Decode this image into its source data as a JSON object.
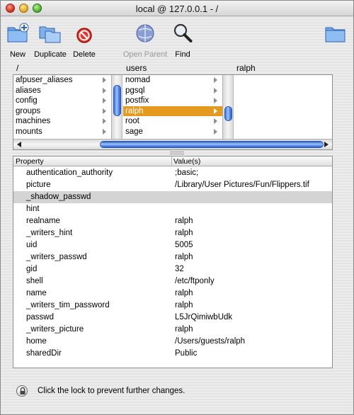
{
  "window": {
    "title": "local @ 127.0.0.1 - /"
  },
  "toolbar": {
    "new_label": "New",
    "duplicate_label": "Duplicate",
    "delete_label": "Delete",
    "open_parent_label": "Open Parent",
    "find_label": "Find"
  },
  "browser": {
    "column_headers": [
      "/",
      "users",
      "ralph"
    ],
    "column1_items": [
      "afpuser_aliases",
      "aliases",
      "config",
      "groups",
      "machines",
      "mounts"
    ],
    "column2_items": [
      "nomad",
      "pgsql",
      "postfix",
      "ralph",
      "root",
      "sage"
    ],
    "column2_selected": "ralph"
  },
  "properties": {
    "header_property": "Property",
    "header_value": "Value(s)",
    "rows": [
      {
        "name": "authentication_authority",
        "value": ";basic;"
      },
      {
        "name": "picture",
        "value": "/Library/User Pictures/Fun/Flippers.tif"
      },
      {
        "name": "_shadow_passwd",
        "value": ""
      },
      {
        "name": "hint",
        "value": ""
      },
      {
        "name": "realname",
        "value": "ralph"
      },
      {
        "name": "_writers_hint",
        "value": "ralph"
      },
      {
        "name": "uid",
        "value": "5005"
      },
      {
        "name": "_writers_passwd",
        "value": "ralph"
      },
      {
        "name": "gid",
        "value": "32"
      },
      {
        "name": "shell",
        "value": "/etc/ftponly"
      },
      {
        "name": "name",
        "value": "ralph"
      },
      {
        "name": "_writers_tim_password",
        "value": "ralph"
      },
      {
        "name": "passwd",
        "value": "L5JrQimiwbUdk"
      },
      {
        "name": "_writers_picture",
        "value": "ralph"
      },
      {
        "name": "home",
        "value": "/Users/guests/ralph"
      },
      {
        "name": "sharedDir",
        "value": "Public"
      }
    ],
    "selected_row": "_shadow_passwd"
  },
  "lock": {
    "text": "Click the lock to prevent further changes."
  },
  "colors": {
    "selection": "#e39a1f",
    "scroll_thumb": "#5d8fe8",
    "row_selected": "#d4d4d4"
  },
  "icons": [
    "new-folder-icon",
    "duplicate-icon",
    "delete-icon",
    "open-parent-icon",
    "find-icon",
    "folder-icon",
    "lock-icon"
  ]
}
